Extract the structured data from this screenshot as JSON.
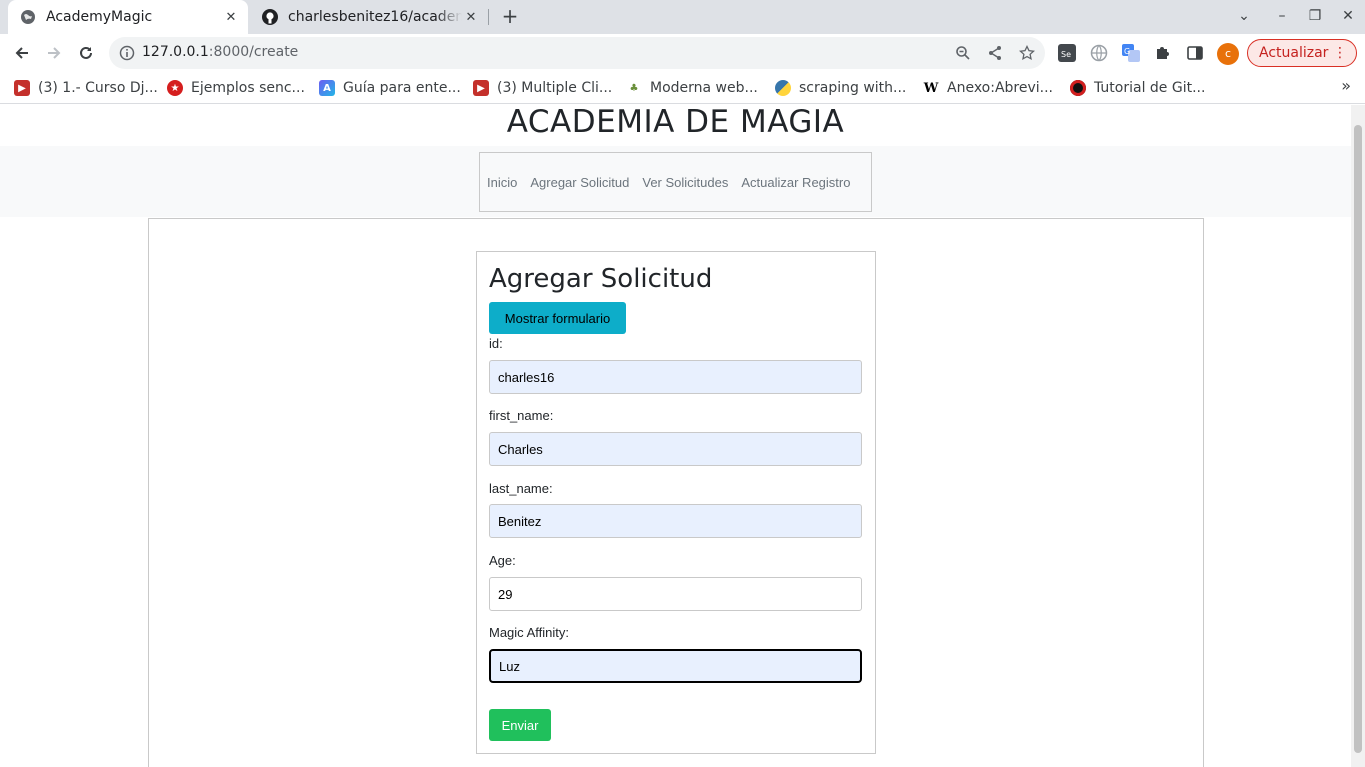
{
  "browser": {
    "tabs": [
      {
        "title": "AcademyMagic",
        "active": true
      },
      {
        "title": "charlesbenitez16/academ",
        "active": false
      }
    ],
    "url_host": "127.0.0.1",
    "url_path": ":8000/create",
    "update_label": "Actualizar",
    "avatar_letter": "c",
    "bookmarks": [
      {
        "label": "(3) 1.- Curso Dj...",
        "icon": "youtube-icon"
      },
      {
        "label": "Ejemplos senc...",
        "icon": "red-circle-icon"
      },
      {
        "label": "Guía para ente...",
        "icon": "blue-a-icon"
      },
      {
        "label": "(3) Multiple Cli...",
        "icon": "youtube-icon"
      },
      {
        "label": "Moderna web...",
        "icon": "tree-icon"
      },
      {
        "label": "scraping with...",
        "icon": "python-icon"
      },
      {
        "label": "Anexo:Abrevi...",
        "icon": "wikipedia-icon"
      },
      {
        "label": "Tutorial de Git...",
        "icon": "red-black-circle-icon"
      }
    ]
  },
  "page": {
    "title": "ACADEMIA DE MAGIA",
    "nav": [
      "Inicio",
      "Agregar Solicitud",
      "Ver Solicitudes",
      "Actualizar Registro"
    ],
    "form": {
      "heading": "Agregar Solicitud",
      "toggle_label": "Mostrar formulario",
      "fields": [
        {
          "label": "id:",
          "value": "charles16"
        },
        {
          "label": "first_name:",
          "value": "Charles"
        },
        {
          "label": "last_name:",
          "value": "Benitez"
        },
        {
          "label": "Age:",
          "value": "29"
        },
        {
          "label": "Magic Affinity:",
          "value": "Luz"
        }
      ],
      "submit_label": "Enviar"
    }
  },
  "colors": {
    "toggle_button": "#0dadc9",
    "submit_button": "#20c05c",
    "autofill_bg": "#e8f0fe",
    "update_button": "#d93025"
  }
}
